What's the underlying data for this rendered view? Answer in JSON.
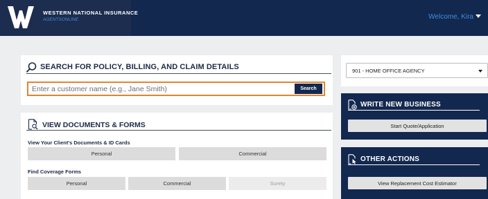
{
  "header": {
    "brand_name": "WESTERN NATIONAL INSURANCE",
    "brand_sub": "AGENTSONLINE",
    "welcome_text": "Welcome, Kira",
    "colors": {
      "navy": "#13284f",
      "accent_blue": "#3c8de0",
      "focus_orange": "#e8822c"
    }
  },
  "search": {
    "title": "SEARCH FOR POLICY, BILLING, AND CLAIM DETAILS",
    "icon": "search-icon",
    "placeholder": "Enter a customer name (e.g., Jane Smith)",
    "value": "",
    "button_label": "Search"
  },
  "documents": {
    "title": "VIEW DOCUMENTS & FORMS",
    "icon": "document-search-icon",
    "client_docs": {
      "label": "View Your Client's Documents & ID Cards",
      "buttons": [
        "Personal",
        "Commercial"
      ]
    },
    "coverage_forms": {
      "label": "Find Coverage Forms",
      "buttons": [
        "Personal",
        "Commercial",
        "Surety"
      ],
      "disabled": [
        "Surety"
      ]
    }
  },
  "agency": {
    "selected": "901 - HOME OFFICE AGENCY"
  },
  "write_new_business": {
    "title": "WRITE NEW BUSINESS",
    "icon": "new-document-icon",
    "button_label": "Start Quote/Application"
  },
  "other_actions": {
    "title": "OTHER ACTIONS",
    "icon": "document-pointer-icon",
    "button_label": "View Replacement Cost Estimator"
  }
}
